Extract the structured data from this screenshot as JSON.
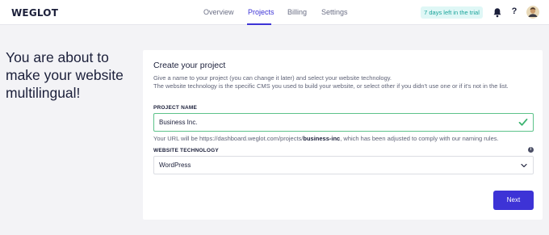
{
  "header": {
    "logo": "WEGLOT",
    "nav": [
      {
        "label": "Overview",
        "active": false
      },
      {
        "label": "Projects",
        "active": true
      },
      {
        "label": "Billing",
        "active": false
      },
      {
        "label": "Settings",
        "active": false
      }
    ],
    "trial_badge": "7 days left in the trial",
    "icons": [
      "bell-icon",
      "help-icon",
      "avatar"
    ],
    "help_glyph": "?"
  },
  "main": {
    "headline": "You are about to make your website multilingual!"
  },
  "card": {
    "title": "Create your project",
    "description_line1": "Give a name to your project (you can change it later) and select your website technology.",
    "description_line2": "The website technology is the specific CMS you used to build your website, or select other if you didn't use one or if it's not in the list.",
    "project_name": {
      "label": "PROJECT NAME",
      "value": "Business Inc.",
      "valid": true
    },
    "url_hint": {
      "prefix": "Your URL will be https://dashboard.weglot.com/projects/",
      "slug": "business-inc",
      "suffix": ", which has been adjusted to comply with our naming rules."
    },
    "website_technology": {
      "label": "WEBSITE TECHNOLOGY",
      "selected": "WordPress",
      "info_glyph": "i"
    },
    "next_label": "Next"
  },
  "colors": {
    "accent": "#3d33d6",
    "success": "#5dc38a",
    "trial_bg": "#dff7f6",
    "trial_text": "#1aa39a",
    "background": "#f3f3f6"
  }
}
